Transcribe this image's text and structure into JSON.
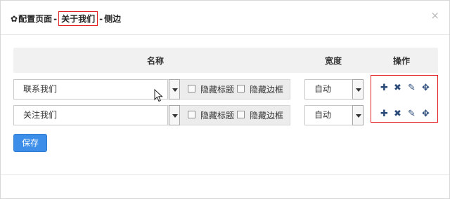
{
  "header": {
    "gear_icon": "gear-icon",
    "title_prefix": "配置页面",
    "separator1": "-",
    "highlight": "关于我们",
    "separator2": "-",
    "title_suffix": "侧边",
    "close": "×"
  },
  "table": {
    "col_name": "名称",
    "col_width": "宽度",
    "col_ops": "操作"
  },
  "rows": [
    {
      "name": "联系我们",
      "hide_title": "隐藏标题",
      "hide_border": "隐藏边框",
      "width": "自动"
    },
    {
      "name": "关注我们",
      "hide_title": "隐藏标题",
      "hide_border": "隐藏边框",
      "width": "自动"
    }
  ],
  "ops": {
    "add": "✚",
    "remove": "✖",
    "edit": "✎",
    "move": "✥"
  },
  "save_label": "保存",
  "colors": {
    "highlight_border": "#e02020",
    "primary": "#3c8ee8",
    "op_icon": "#2a4a7a"
  }
}
